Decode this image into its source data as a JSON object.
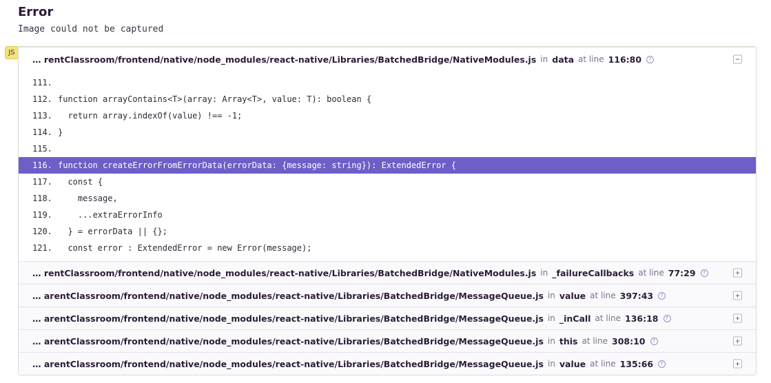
{
  "error": {
    "title": "Error",
    "message": "Image could not be captured"
  },
  "platform_badge": "JS",
  "frames": [
    {
      "file": "… rentClassroom/frontend/native/node_modules/react-native/Libraries/BatchedBridge/NativeModules.js",
      "in_label": "in",
      "function": "data",
      "at_line_label": "at line",
      "line": "116:80",
      "expanded": true,
      "toggle_symbol": "−"
    },
    {
      "file": "… rentClassroom/frontend/native/node_modules/react-native/Libraries/BatchedBridge/NativeModules.js",
      "in_label": "in",
      "function": "_failureCallbacks",
      "at_line_label": "at line",
      "line": "77:29",
      "expanded": false,
      "toggle_symbol": "+"
    },
    {
      "file": "… arentClassroom/frontend/native/node_modules/react-native/Libraries/BatchedBridge/MessageQueue.js",
      "in_label": "in",
      "function": "value",
      "at_line_label": "at line",
      "line": "397:43",
      "expanded": false,
      "toggle_symbol": "+"
    },
    {
      "file": "… arentClassroom/frontend/native/node_modules/react-native/Libraries/BatchedBridge/MessageQueue.js",
      "in_label": "in",
      "function": "_inCall",
      "at_line_label": "at line",
      "line": "136:18",
      "expanded": false,
      "toggle_symbol": "+"
    },
    {
      "file": "… arentClassroom/frontend/native/node_modules/react-native/Libraries/BatchedBridge/MessageQueue.js",
      "in_label": "in",
      "function": "this",
      "at_line_label": "at line",
      "line": "308:10",
      "expanded": false,
      "toggle_symbol": "+"
    },
    {
      "file": "… arentClassroom/frontend/native/node_modules/react-native/Libraries/BatchedBridge/MessageQueue.js",
      "in_label": "in",
      "function": "value",
      "at_line_label": "at line",
      "line": "135:66",
      "expanded": false,
      "toggle_symbol": "+"
    }
  ],
  "code": {
    "active_line": "116.",
    "lines": [
      {
        "num": "111.",
        "text": ""
      },
      {
        "num": "112.",
        "text": "function arrayContains<T>(array: Array<T>, value: T): boolean {"
      },
      {
        "num": "113.",
        "text": "  return array.indexOf(value) !== -1;"
      },
      {
        "num": "114.",
        "text": "}"
      },
      {
        "num": "115.",
        "text": ""
      },
      {
        "num": "116.",
        "text": "function createErrorFromErrorData(errorData: {message: string}): ExtendedError {"
      },
      {
        "num": "117.",
        "text": "  const {"
      },
      {
        "num": "118.",
        "text": "    message,"
      },
      {
        "num": "119.",
        "text": "    ...extraErrorInfo"
      },
      {
        "num": "120.",
        "text": "  } = errorData || {};"
      },
      {
        "num": "121.",
        "text": "  const error : ExtendedError = new Error(message);"
      }
    ]
  },
  "colors": {
    "highlight": "#6c5fc7",
    "badge": "#f3e37a",
    "text": "#2b1d38",
    "muted": "#80708f"
  }
}
